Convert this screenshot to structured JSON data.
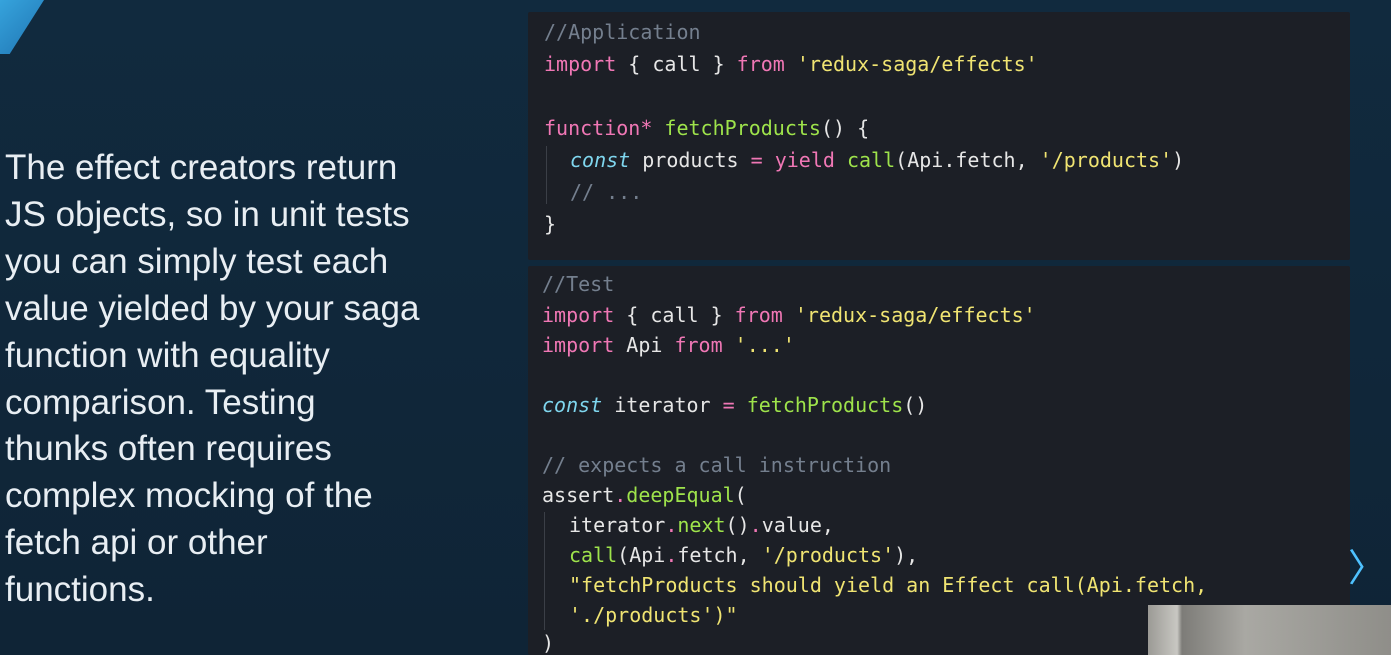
{
  "body_text": "The effect creators return\nJS objects, so in unit tests\nyou can simply test each\nvalue yielded by your saga\nfunction with equality\ncomparison. Testing\nthunks often requires\ncomplex mocking of the\nfetch api or other\nfunctions.",
  "app_code": {
    "comment": "//Application",
    "l2_import": "import",
    "l2_mid": " { call } ",
    "l2_from": "from",
    "l2_str": " 'redux-saga/effects'",
    "l4_fn": "function*",
    "l4_name": " fetchProducts",
    "l4_rest": "() {",
    "l5_const": "const",
    "l5_var": " products ",
    "l5_eq": "=",
    "l5_yield": " yield",
    "l5_call": " call",
    "l5_args": "(Api.fetch, ",
    "l5_str": "'/products'",
    "l5_close": ")",
    "l6_comment": "// ...",
    "l7_close": "}"
  },
  "test_code": {
    "comment": "//Test",
    "l2_import": "import",
    "l2_mid": " { call } ",
    "l2_from": "from",
    "l2_str": " 'redux-saga/effects'",
    "l3_import": "import",
    "l3_mid": " Api ",
    "l3_from": "from",
    "l3_str": " '...'",
    "l5_const": "const",
    "l5_var": " iterator ",
    "l5_eq": "=",
    "l5_fn": " fetchProducts",
    "l5_close": "()",
    "l7_comment": "// expects a call instruction",
    "l8_obj": "assert",
    "l8_dot": ".",
    "l8_fn": "deepEqual",
    "l8_paren": "(",
    "l9_a": "iterator",
    "l9_dot1": ".",
    "l9_next": "next",
    "l9_b": "()",
    "l9_dot2": ".",
    "l9_c": "value,",
    "l10_call": "call",
    "l10_args": "(Api",
    "l10_dot": ".",
    "l10_fetch": "fetch, ",
    "l10_str": "'/products'",
    "l10_close": "),",
    "l11_str": "\"fetchProducts should yield an Effect call(Api.fetch,",
    "l12_str": "'./products')\"",
    "l13_close": ")"
  },
  "nav": {
    "next_glyph": "〉"
  },
  "colors": {
    "background": "#112a3e",
    "code_bg": "#1c1f26",
    "keyword": "#f077b5",
    "function": "#9ee34b",
    "string": "#f0e472",
    "comment": "#747f8e",
    "accent": "#4ec2ff"
  }
}
